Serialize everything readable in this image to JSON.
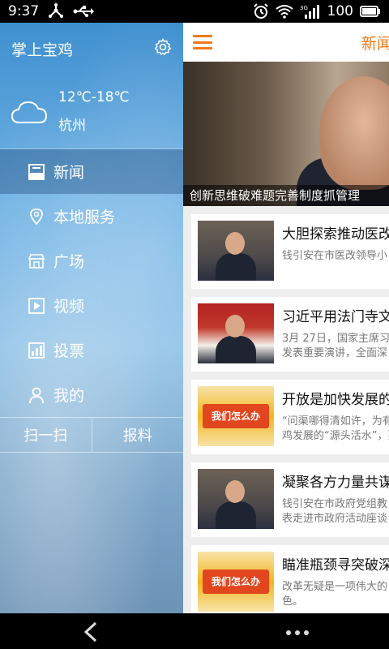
{
  "status_bar": {
    "time": "9:37",
    "battery": "100",
    "icons": [
      "usb-tether-icon",
      "usb-icon",
      "alarm-icon",
      "wifi-icon",
      "signal-3g-icon",
      "battery-icon"
    ]
  },
  "drawer": {
    "title": "掌上宝鸡",
    "weather": {
      "temp": "12℃-18℃",
      "city": "杭州",
      "icon": "cloud-icon"
    },
    "menu": [
      {
        "label": "新闻",
        "icon": "news-icon",
        "active": true
      },
      {
        "label": "本地服务",
        "icon": "location-icon"
      },
      {
        "label": "广场",
        "icon": "store-icon"
      },
      {
        "label": "视频",
        "icon": "video-icon"
      },
      {
        "label": "投票",
        "icon": "chart-icon"
      },
      {
        "label": "我的",
        "icon": "user-icon"
      }
    ],
    "buttons": [
      {
        "label": "扫一扫"
      },
      {
        "label": "报料"
      }
    ]
  },
  "main": {
    "title": "新闻",
    "hero": {
      "caption": "创新思维破难题完善制度抓管理"
    },
    "news": [
      {
        "title": "大胆探索推动医改",
        "desc": [
          "钱引安在市医改领导小"
        ],
        "thumb": "people"
      },
      {
        "title": "习近平用法门寺文",
        "desc": [
          "3月 27日，国家主席习",
          "发表重要演讲，全面深"
        ],
        "thumb": "flags"
      },
      {
        "title": "开放是加快发展的",
        "desc": [
          "“问渠哪得清如许，为有",
          "鸡发展的“源头活水”，要"
        ],
        "thumb": "banner",
        "banner": "我们怎么办"
      },
      {
        "title": "凝聚各方力量共谋",
        "desc": [
          "钱引安在市政府党组教",
          "表走进市政府活动座谈"
        ],
        "thumb": "people"
      },
      {
        "title": "瞄准瓶颈寻突破深",
        "desc": [
          "改革无疑是一项伟大的",
          "色。"
        ],
        "thumb": "banner",
        "banner": "我们怎么办"
      }
    ]
  },
  "colors": {
    "accent": "#f07a1a",
    "drawer_blue": "#5fa6dd"
  }
}
